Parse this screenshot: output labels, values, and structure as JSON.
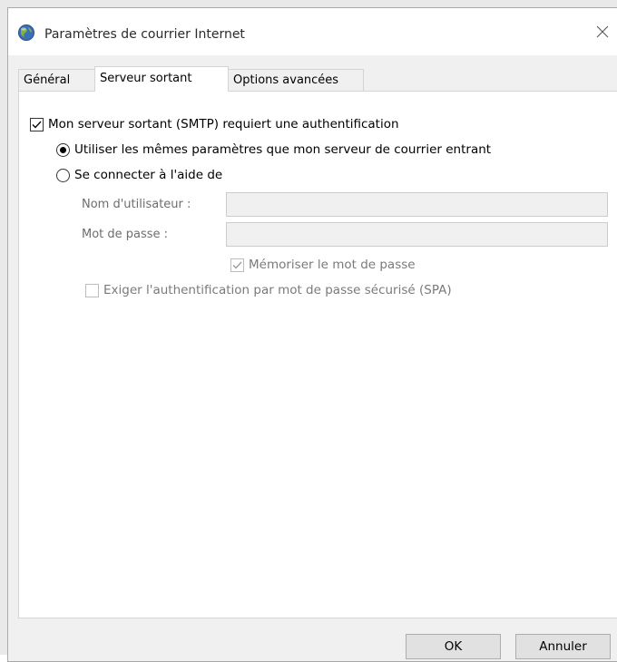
{
  "window": {
    "title": "Paramètres de courrier Internet"
  },
  "tabs": [
    {
      "label": "Général",
      "active": false
    },
    {
      "label": "Serveur sortant",
      "active": true
    },
    {
      "label": "Options avancées",
      "active": false
    }
  ],
  "outgoing": {
    "smtp_auth": {
      "label": "Mon serveur sortant (SMTP) requiert une authentification",
      "checked": true
    },
    "same_settings": {
      "label": "Utiliser les mêmes paramètres que mon serveur de courrier entrant",
      "selected": true
    },
    "login_with": {
      "label": "Se connecter à l'aide de",
      "selected": false
    },
    "username": {
      "label": "Nom d'utilisateur :",
      "value": ""
    },
    "password": {
      "label": "Mot de passe :",
      "value": ""
    },
    "remember_password": {
      "label": "Mémoriser le mot de passe",
      "checked": true,
      "enabled": false
    },
    "spa": {
      "label": "Exiger l'authentification par mot de passe sécurisé (SPA)",
      "checked": false,
      "enabled": false
    }
  },
  "buttons": {
    "ok": "OK",
    "cancel": "Annuler"
  },
  "icons": {
    "app": "globe-mail-icon",
    "close": "close-icon",
    "check": "checkmark-icon"
  }
}
